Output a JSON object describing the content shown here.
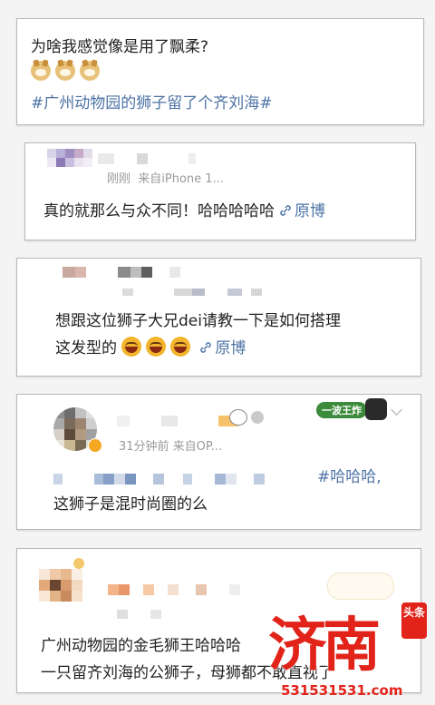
{
  "post": {
    "line1": "为啥我感觉像是用了飘柔?",
    "emojis": [
      "doge",
      "doge",
      "doge"
    ],
    "hashtag": "#广州动物园的狮子留了个齐刘海#"
  },
  "comments": [
    {
      "meta_time": "刚刚",
      "meta_source": "来自iPhone 1...",
      "text": "真的就那么与众不同！哈哈哈哈哈",
      "link_label": "原博"
    },
    {
      "text_line1": "想跟这位狮子大兄dei请教一下是如何搭理",
      "text_line2": "这发型的",
      "emojis": [
        "laugh",
        "laugh",
        "laugh"
      ],
      "link_label": "原博"
    },
    {
      "badge": "一波王炸",
      "meta": "31分钟前 来自OP...",
      "hashtag_tail": "#哈哈哈,",
      "text": "这狮子是混时尚圈的么"
    },
    {
      "text_line1": "广州动物园的金毛狮王哈哈哈",
      "text_line2": "一只留齐刘海的公狮子，母狮都不敢直视了"
    }
  ],
  "watermark": {
    "big": "济南",
    "url": "531531531.com",
    "corner": "头条"
  },
  "colors": {
    "link_blue": "#4e73a6",
    "watermark_red": "#e2231a"
  }
}
